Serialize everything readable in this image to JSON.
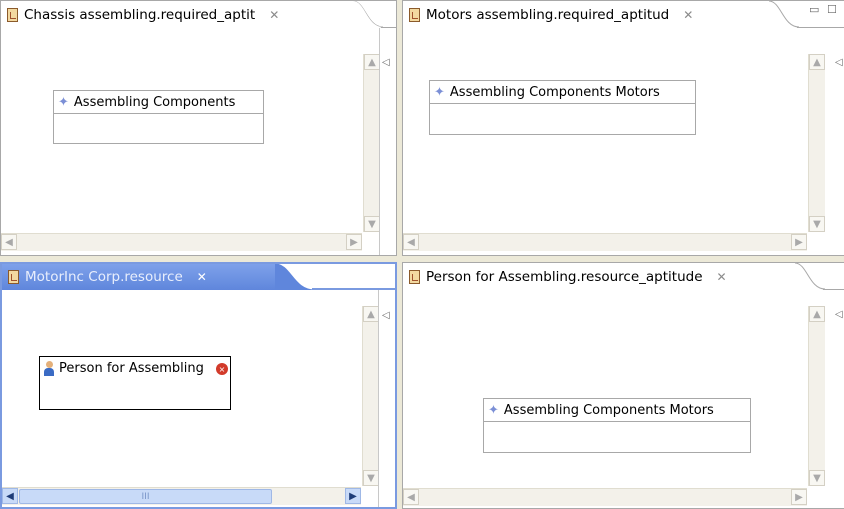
{
  "editors": {
    "top_left": {
      "title": "Chassis assembling.required_aptit",
      "close": "✕",
      "node_label": "Assembling Components"
    },
    "top_right": {
      "title": "Motors assembling.required_aptitud",
      "close": "✕",
      "node_label": "Assembling Components Motors"
    },
    "bottom_left": {
      "title": "MotorInc Corp.resource",
      "close": "✕",
      "node_label": "Person for Assembling",
      "thumb_grip": "III"
    },
    "bottom_right": {
      "title": "Person for Assembling.resource_aptitude",
      "close": "✕",
      "node_label": "Assembling Components Motors"
    }
  },
  "icons": {
    "editor": "document-icon",
    "node": "diamond-icon",
    "person": "person-icon",
    "error": "error-badge-icon"
  },
  "colors": {
    "active_tab": "#7a9ae0",
    "node_icon": "#7b8fd6",
    "background": "#ece9d8"
  }
}
